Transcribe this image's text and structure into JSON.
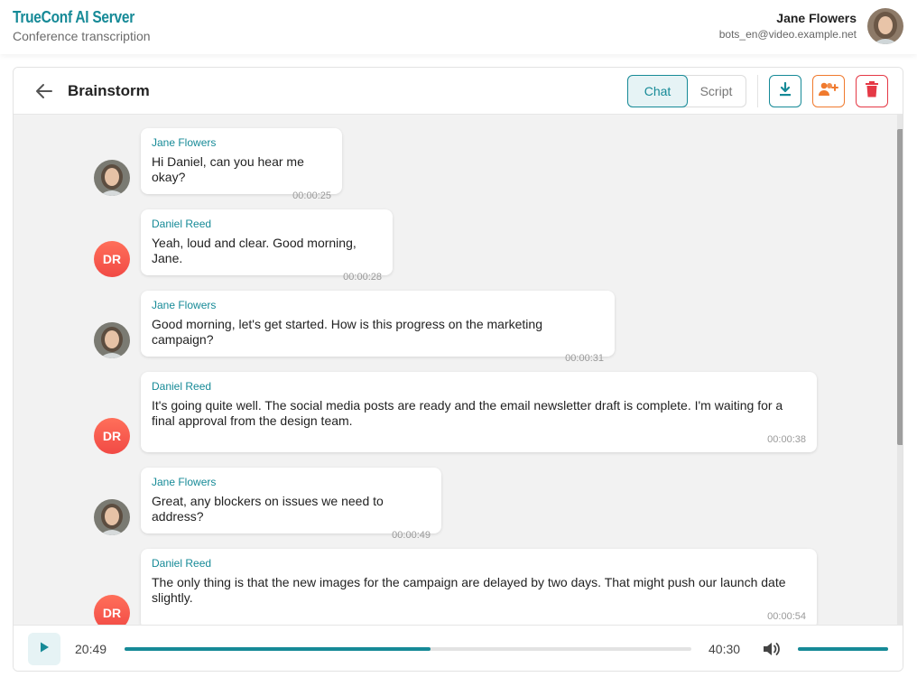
{
  "app": {
    "brand": "TrueConf AI Server",
    "subtitle": "Conference transcription"
  },
  "user": {
    "name": "Jane Flowers",
    "email": "bots_en@video.example.net"
  },
  "conversation": {
    "title": "Brainstorm",
    "tabs": [
      {
        "label": "Chat",
        "active": true
      },
      {
        "label": "Script",
        "active": false
      }
    ],
    "actions": [
      {
        "icon": "download-icon",
        "color": "#168a97"
      },
      {
        "icon": "add-user-icon",
        "color": "#f07a2e"
      },
      {
        "icon": "trash-icon",
        "color": "#e53946"
      }
    ]
  },
  "messages": [
    {
      "sender": "Jane Flowers",
      "avatar": "photo",
      "text": "Hi Daniel, can you hear me okay?",
      "time": "00:00:25"
    },
    {
      "sender": "Daniel Reed",
      "avatar": "DR",
      "text": "Yeah, loud and clear. Good morning, Jane.",
      "time": "00:00:28"
    },
    {
      "sender": "Jane Flowers",
      "avatar": "photo",
      "text": "Good morning, let's get started. How is this progress on the marketing campaign?",
      "time": "00:00:31"
    },
    {
      "sender": "Daniel Reed",
      "avatar": "DR",
      "text": "It's going quite well. The social media posts are ready and the email newsletter draft is complete. I'm waiting for a final approval from the design team.",
      "time": "00:00:38"
    },
    {
      "sender": "Jane Flowers",
      "avatar": "photo",
      "text": "Great, any blockers on issues we need to address?",
      "time": "00:00:49"
    },
    {
      "sender": "Daniel Reed",
      "avatar": "DR",
      "text": "The only thing is that the new images for the campaign are delayed by two days. That might push our launch date slightly.",
      "time": "00:00:54"
    }
  ],
  "player": {
    "current": "20:49",
    "total": "40:30",
    "progress": 0.54,
    "volume": 1.0
  },
  "colors": {
    "accent": "#168a97",
    "orange": "#f07a2e",
    "red": "#e53946",
    "avatar_initials_bg": "#f14a45"
  }
}
